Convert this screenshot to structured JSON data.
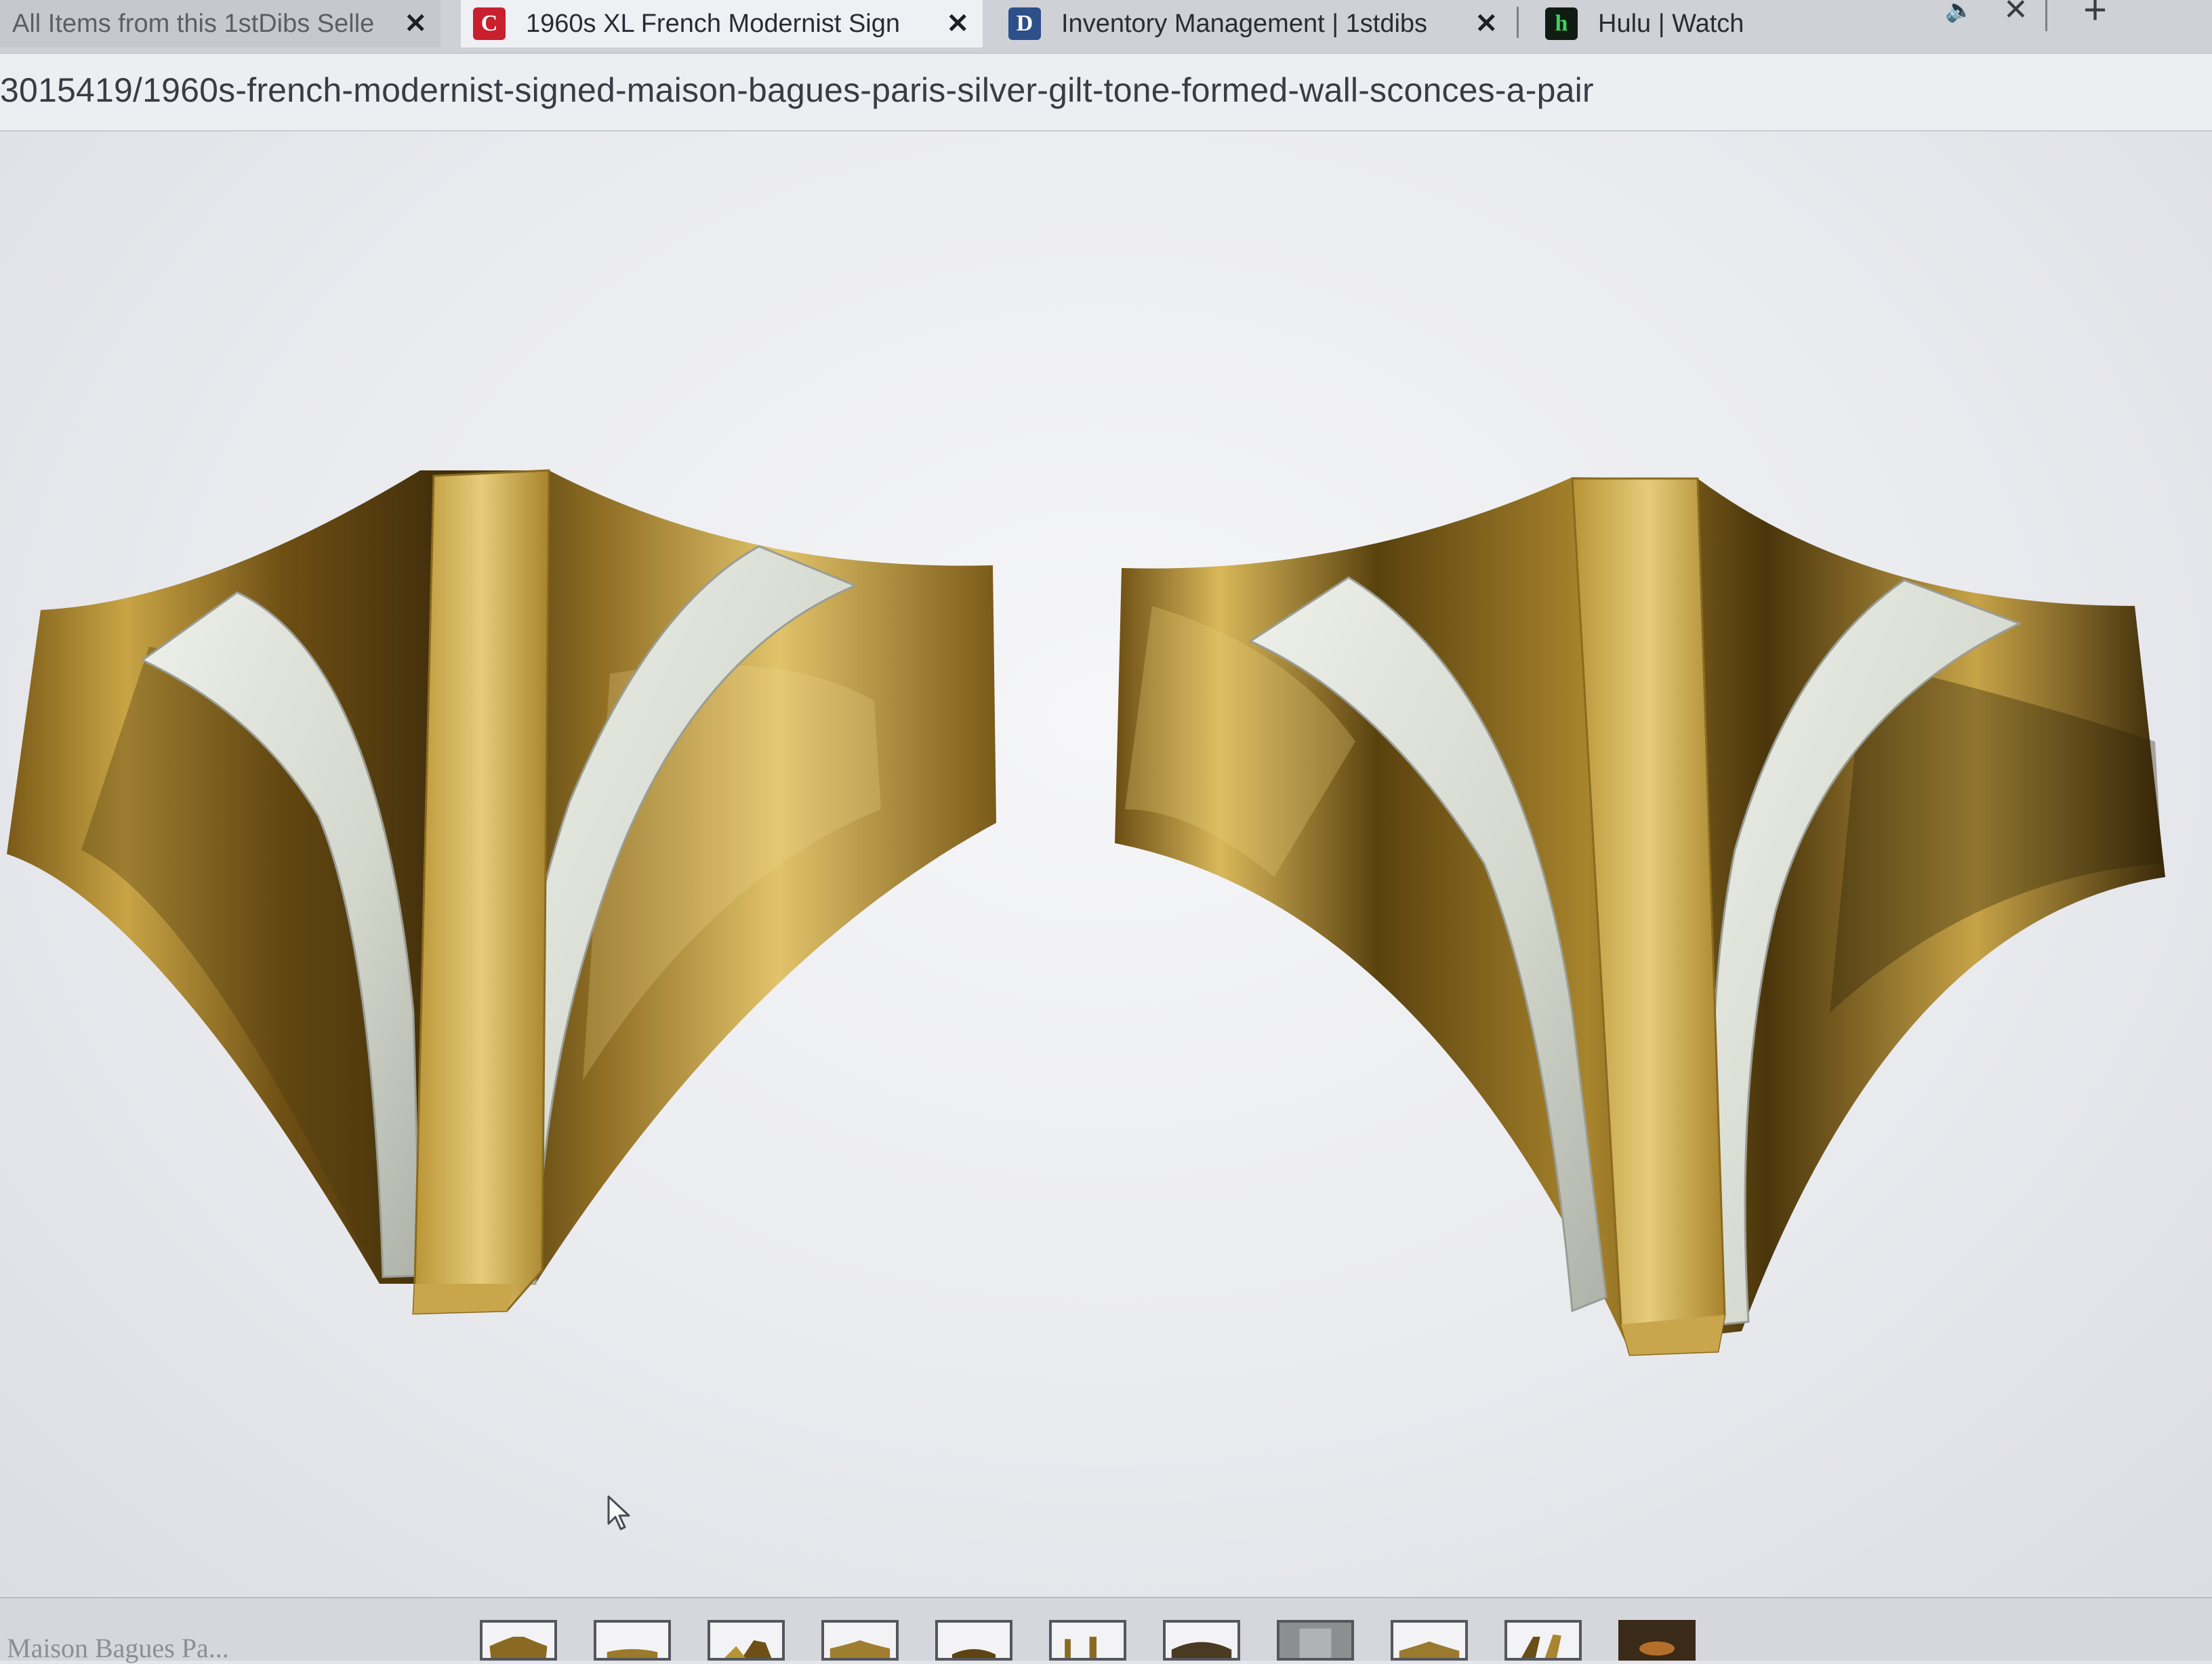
{
  "browser": {
    "tabs": [
      {
        "title": "All Items from this 1stDibs Selle",
        "favicon": "",
        "favicon_color": "#cfd1d6",
        "active": false
      },
      {
        "title": "1960s XL French Modernist Sign",
        "favicon": "C",
        "favicon_color": "#c8202f",
        "active": true
      },
      {
        "title": "Inventory Management | 1stdibs",
        "favicon": "D",
        "favicon_color": "#2d4f8a",
        "active": false
      },
      {
        "title": "Hulu | Watch",
        "favicon": "h",
        "favicon_color": "#1d8a3a",
        "active": false
      }
    ],
    "close_glyph": "✕",
    "new_tab_glyph": "+",
    "mute_glyph": "🔈",
    "url": "3015419/1960s-french-modernist-signed-maison-bagues-paris-silver-gilt-tone-formed-wall-sconces-a-pair"
  },
  "product": {
    "image_subject": "pair of brass and silver-tone formed wall sconces",
    "colors": {
      "brass": "#a8842c",
      "silver": "#d8dcd2"
    }
  },
  "footer": {
    "caption": "Maison Bagues Pa...",
    "thumbnail_count": 11
  }
}
